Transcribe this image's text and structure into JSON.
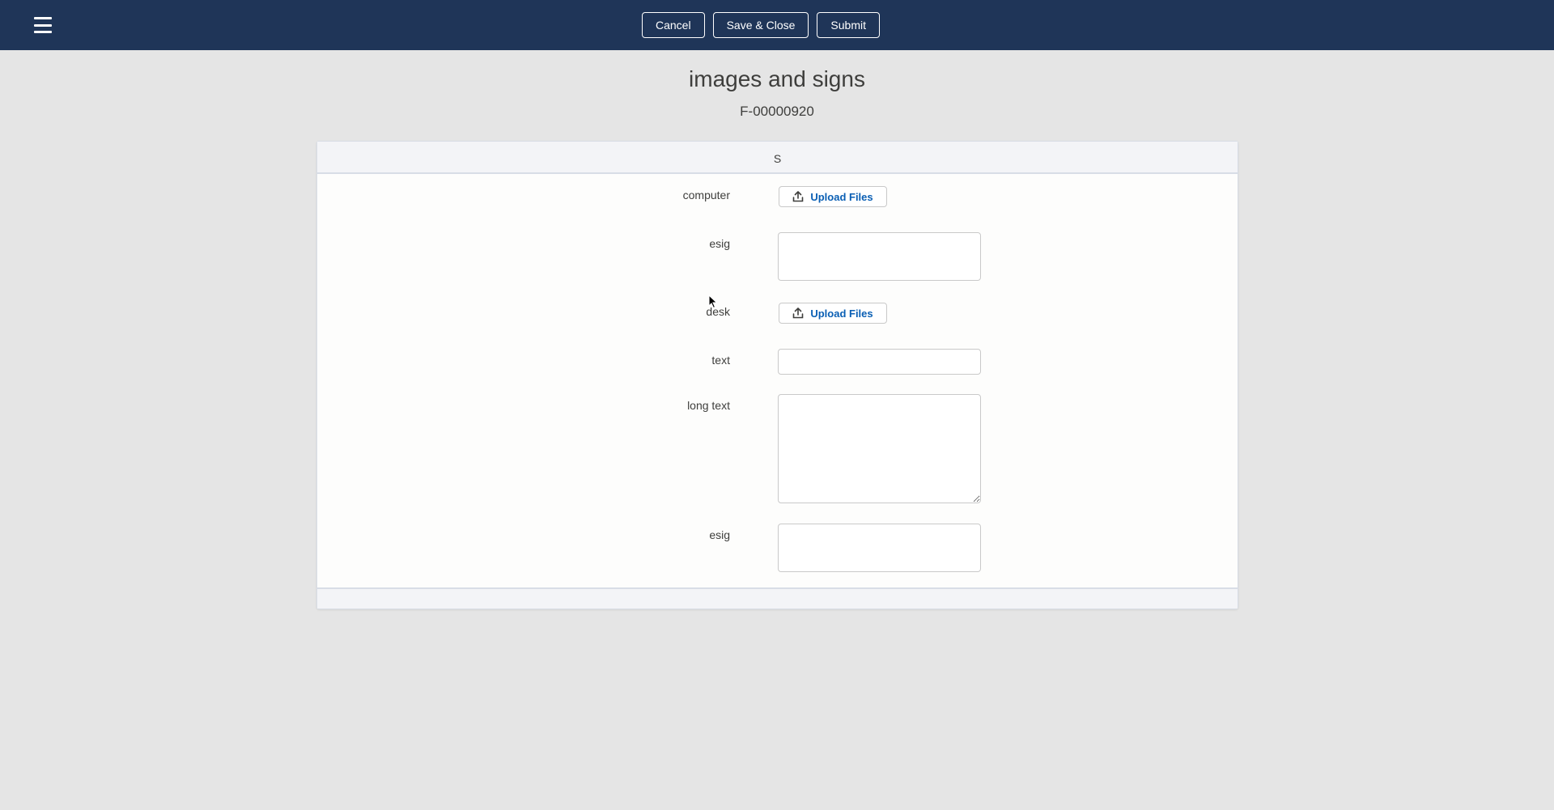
{
  "topbar": {
    "menu_icon": "hamburger-menu-icon",
    "buttons": {
      "cancel": "Cancel",
      "save_close": "Save & Close",
      "submit": "Submit"
    },
    "background": "#1f3558"
  },
  "header": {
    "title": "images and signs",
    "record_id": "F-00000920"
  },
  "section": {
    "title": "S",
    "fields": {
      "computer": {
        "label": "computer",
        "button": "Upload Files"
      },
      "esig_1": {
        "label": "esig"
      },
      "desk": {
        "label": "desk",
        "button": "Upload Files"
      },
      "text": {
        "label": "text",
        "value": ""
      },
      "long_text": {
        "label": "long text",
        "value": ""
      },
      "esig_2": {
        "label": "esig"
      }
    }
  },
  "colors": {
    "page_bg": "#e5e5e5",
    "link_blue": "#0a5fb4"
  }
}
